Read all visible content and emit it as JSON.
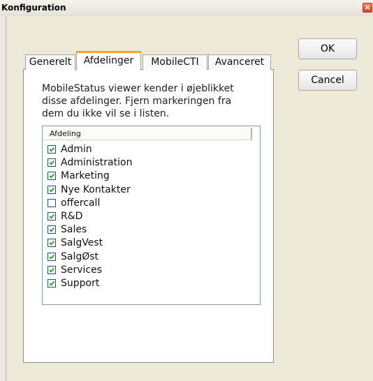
{
  "window": {
    "title": "Konfiguration",
    "close_symbol": "×"
  },
  "buttons": {
    "ok": "OK",
    "cancel": "Cancel"
  },
  "tabs": [
    "Generelt",
    "Afdelinger",
    "MobileCTI",
    "Avanceret"
  ],
  "active_tab": "Afdelinger",
  "panel": {
    "intro_lines": [
      "MobileStatus viewer kender i øjeblikket",
      "disse afdelinger. Fjern markeringen fra",
      "dem du ikke vil se i listen."
    ],
    "list_header": "Afdeling",
    "items": [
      {
        "label": "Admin",
        "checked": true
      },
      {
        "label": "Administration",
        "checked": true
      },
      {
        "label": "Marketing",
        "checked": true
      },
      {
        "label": "Nye Kontakter",
        "checked": true
      },
      {
        "label": "offercall",
        "checked": false
      },
      {
        "label": "R&D",
        "checked": true
      },
      {
        "label": "Sales",
        "checked": true
      },
      {
        "label": "SalgVest",
        "checked": true
      },
      {
        "label": "SalgØst",
        "checked": true
      },
      {
        "label": "Services",
        "checked": true
      },
      {
        "label": "Support",
        "checked": true
      }
    ]
  },
  "colors": {
    "tab_accent": "#f5a623",
    "checkmark": "#21a121",
    "checkbox_border": "#1c5180"
  }
}
